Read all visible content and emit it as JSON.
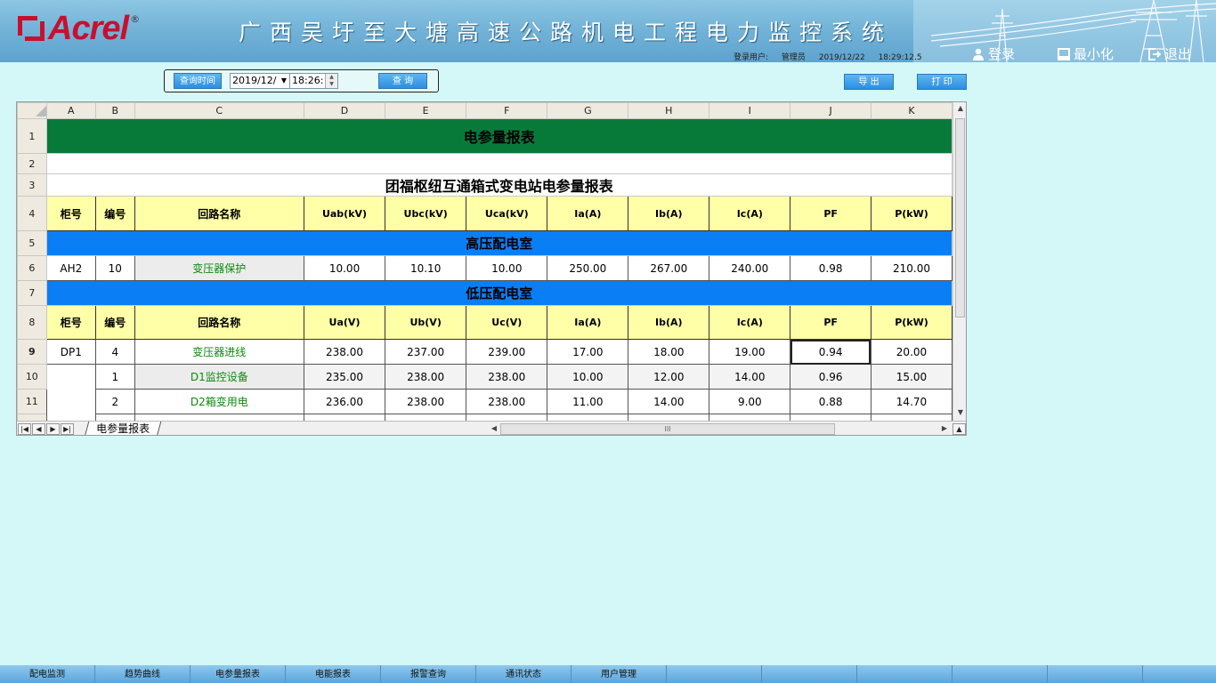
{
  "header": {
    "logo_text": "Acrel",
    "logo_reg": "®",
    "title": "广西吴圩至大塘高速公路机电工程电力监控系统",
    "user_label": "登录用户:",
    "user_name": "管理员",
    "date": "2019/12/22",
    "time": "18:29:12.5",
    "login_label": "登录",
    "minimize_label": "最小化",
    "exit_label": "退出"
  },
  "query": {
    "time_label": "查询时间",
    "date_value": "2019/12/",
    "time_value": "18:26:",
    "query_button": "查 询",
    "export_button": "导 出",
    "print_button": "打 印"
  },
  "sheet": {
    "columns": [
      "A",
      "B",
      "C",
      "D",
      "E",
      "F",
      "G",
      "H",
      "I",
      "J",
      "K"
    ],
    "row_numbers": [
      "1",
      "2",
      "3",
      "4",
      "5",
      "6",
      "7",
      "8",
      "9",
      "10",
      "11"
    ],
    "title": "电参量报表",
    "subtitle": "团福枢纽互通箱式变电站电参量报表",
    "hv_header": [
      "柜号",
      "编号",
      "回路名称",
      "Uab(kV)",
      "Ubc(kV)",
      "Uca(kV)",
      "Ia(A)",
      "Ib(A)",
      "Ic(A)",
      "PF",
      "P(kW)"
    ],
    "hv_section": "高压配电室",
    "hv_rows": [
      [
        "AH2",
        "10",
        "变压器保护",
        "10.00",
        "10.10",
        "10.00",
        "250.00",
        "267.00",
        "240.00",
        "0.98",
        "210.00"
      ]
    ],
    "lv_section": "低压配电室",
    "lv_header": [
      "柜号",
      "编号",
      "回路名称",
      "Ua(V)",
      "Ub(V)",
      "Uc(V)",
      "Ia(A)",
      "Ib(A)",
      "Ic(A)",
      "PF",
      "P(kW)"
    ],
    "lv_rows": [
      [
        "DP1",
        "4",
        "变压器进线",
        "238.00",
        "237.00",
        "239.00",
        "17.00",
        "18.00",
        "19.00",
        "0.94",
        "20.00"
      ],
      [
        "",
        "1",
        "D1监控设备",
        "235.00",
        "238.00",
        "238.00",
        "10.00",
        "12.00",
        "14.00",
        "0.96",
        "15.00"
      ],
      [
        "",
        "2",
        "D2箱变用电",
        "236.00",
        "238.00",
        "238.00",
        "11.00",
        "14.00",
        "9.00",
        "0.88",
        "14.70"
      ]
    ],
    "tab_label": "电参量报表",
    "hscroll_grip": "III"
  },
  "nav": [
    "配电监测",
    "趋势曲线",
    "电参量报表",
    "电能报表",
    "报警查询",
    "通讯状态",
    "用户管理",
    "",
    "",
    "",
    "",
    "",
    ""
  ],
  "colors": {
    "title_bg": "#077a3a",
    "section_bg": "#0a7ff5",
    "header_bg": "#ffffa8",
    "circuit_name": "#0c8a0c",
    "page_bg": "#d4f8f8"
  }
}
